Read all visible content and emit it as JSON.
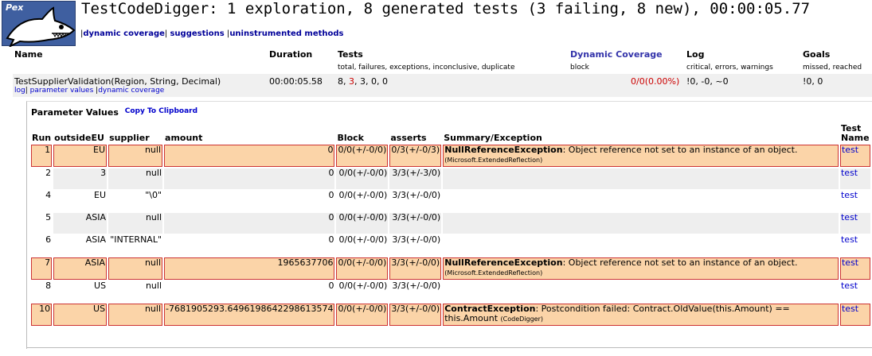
{
  "header": {
    "logo_text": "Pex",
    "title": "TestCodeDigger: 1 exploration, 8 generated tests (3 failing, 8 new), 00:00:05.77",
    "links": [
      "dynamic coverage",
      "suggestions",
      "uninstrumented methods"
    ]
  },
  "summary": {
    "columns": [
      {
        "label": "Name",
        "sub": ""
      },
      {
        "label": "Duration",
        "sub": ""
      },
      {
        "label": "Tests",
        "sub": "total, failures, exceptions, inconclusive, duplicate"
      },
      {
        "label": "Dynamic Coverage",
        "sub": "block"
      },
      {
        "label": "Log",
        "sub": "critical, errors, warnings"
      },
      {
        "label": "Goals",
        "sub": "missed, reached"
      }
    ],
    "row": {
      "name": "TestSupplierValidation(Region, String, Decimal)",
      "links": [
        "log",
        "parameter values",
        "dynamic coverage"
      ],
      "duration": "00:00:05.58",
      "tests_total": "8",
      "tests_failures": "3",
      "tests_rest": "3, 0, 0",
      "coverage": "0/0(0.00%)",
      "log": "!0, -0, ~0",
      "goals": "!0, 0"
    }
  },
  "params": {
    "title": "Parameter Values",
    "copy_link": "Copy To Clipboard",
    "headers": [
      "Run",
      "outsideEU",
      "supplier",
      "amount",
      "Block",
      "asserts",
      "Summary/Exception",
      "Test Name"
    ],
    "rows": [
      {
        "run": "1",
        "outsideEU": "EU",
        "supplier": "null",
        "amount": "0",
        "block": "0/0(+/-0/0)",
        "asserts": "0/3(+/-0/3)",
        "exception": "NullReferenceException",
        "message": ": Object reference not set to an instance of an object.",
        "source": "(Microsoft.ExtendedReflection)",
        "test": "test",
        "status": "fail"
      },
      {
        "run": "2",
        "outsideEU": "3",
        "supplier": "null",
        "amount": "0",
        "block": "0/0(+/-0/0)",
        "asserts": "3/3(+/-3/0)",
        "exception": "",
        "message": "",
        "source": "",
        "test": "test",
        "status": "norm"
      },
      {
        "run": "4",
        "outsideEU": "EU",
        "supplier": "\"\\0\"",
        "amount": "0",
        "block": "0/0(+/-0/0)",
        "asserts": "3/3(+/-0/0)",
        "exception": "",
        "message": "",
        "source": "",
        "test": "test",
        "status": "alt"
      },
      {
        "run": "5",
        "outsideEU": "ASIA",
        "supplier": "null",
        "amount": "0",
        "block": "0/0(+/-0/0)",
        "asserts": "3/3(+/-0/0)",
        "exception": "",
        "message": "",
        "source": "",
        "test": "test",
        "status": "norm"
      },
      {
        "run": "6",
        "outsideEU": "ASIA",
        "supplier": "\"INTERNAL\"",
        "amount": "0",
        "block": "0/0(+/-0/0)",
        "asserts": "3/3(+/-0/0)",
        "exception": "",
        "message": "",
        "source": "",
        "test": "test",
        "status": "alt"
      },
      {
        "run": "7",
        "outsideEU": "ASIA",
        "supplier": "null",
        "amount": "1965637706",
        "block": "0/0(+/-0/0)",
        "asserts": "3/3(+/-0/0)",
        "exception": "NullReferenceException",
        "message": ": Object reference not set to an instance of an object.",
        "source": "(Microsoft.ExtendedReflection)",
        "test": "test",
        "status": "fail"
      },
      {
        "run": "8",
        "outsideEU": "US",
        "supplier": "null",
        "amount": "0",
        "block": "0/0(+/-0/0)",
        "asserts": "3/3(+/-0/0)",
        "exception": "",
        "message": "",
        "source": "",
        "test": "test",
        "status": "alt"
      },
      {
        "run": "10",
        "outsideEU": "US",
        "supplier": "null",
        "amount": "-7681905293.6496198642298613574",
        "block": "0/0(+/-0/0)",
        "asserts": "3/3(+/-0/0)",
        "exception": "ContractException",
        "message": ": Postcondition failed: Contract.OldValue(this.Amount) == this.Amount",
        "source": "(CodeDigger)",
        "test": "test",
        "status": "fail"
      }
    ]
  },
  "colors": {
    "fail_bg": "#fbd4a8",
    "fail_border": "#cc3333",
    "link": "#0000cc",
    "heading_link": "#3333aa",
    "failure_count": "#cc0000"
  }
}
